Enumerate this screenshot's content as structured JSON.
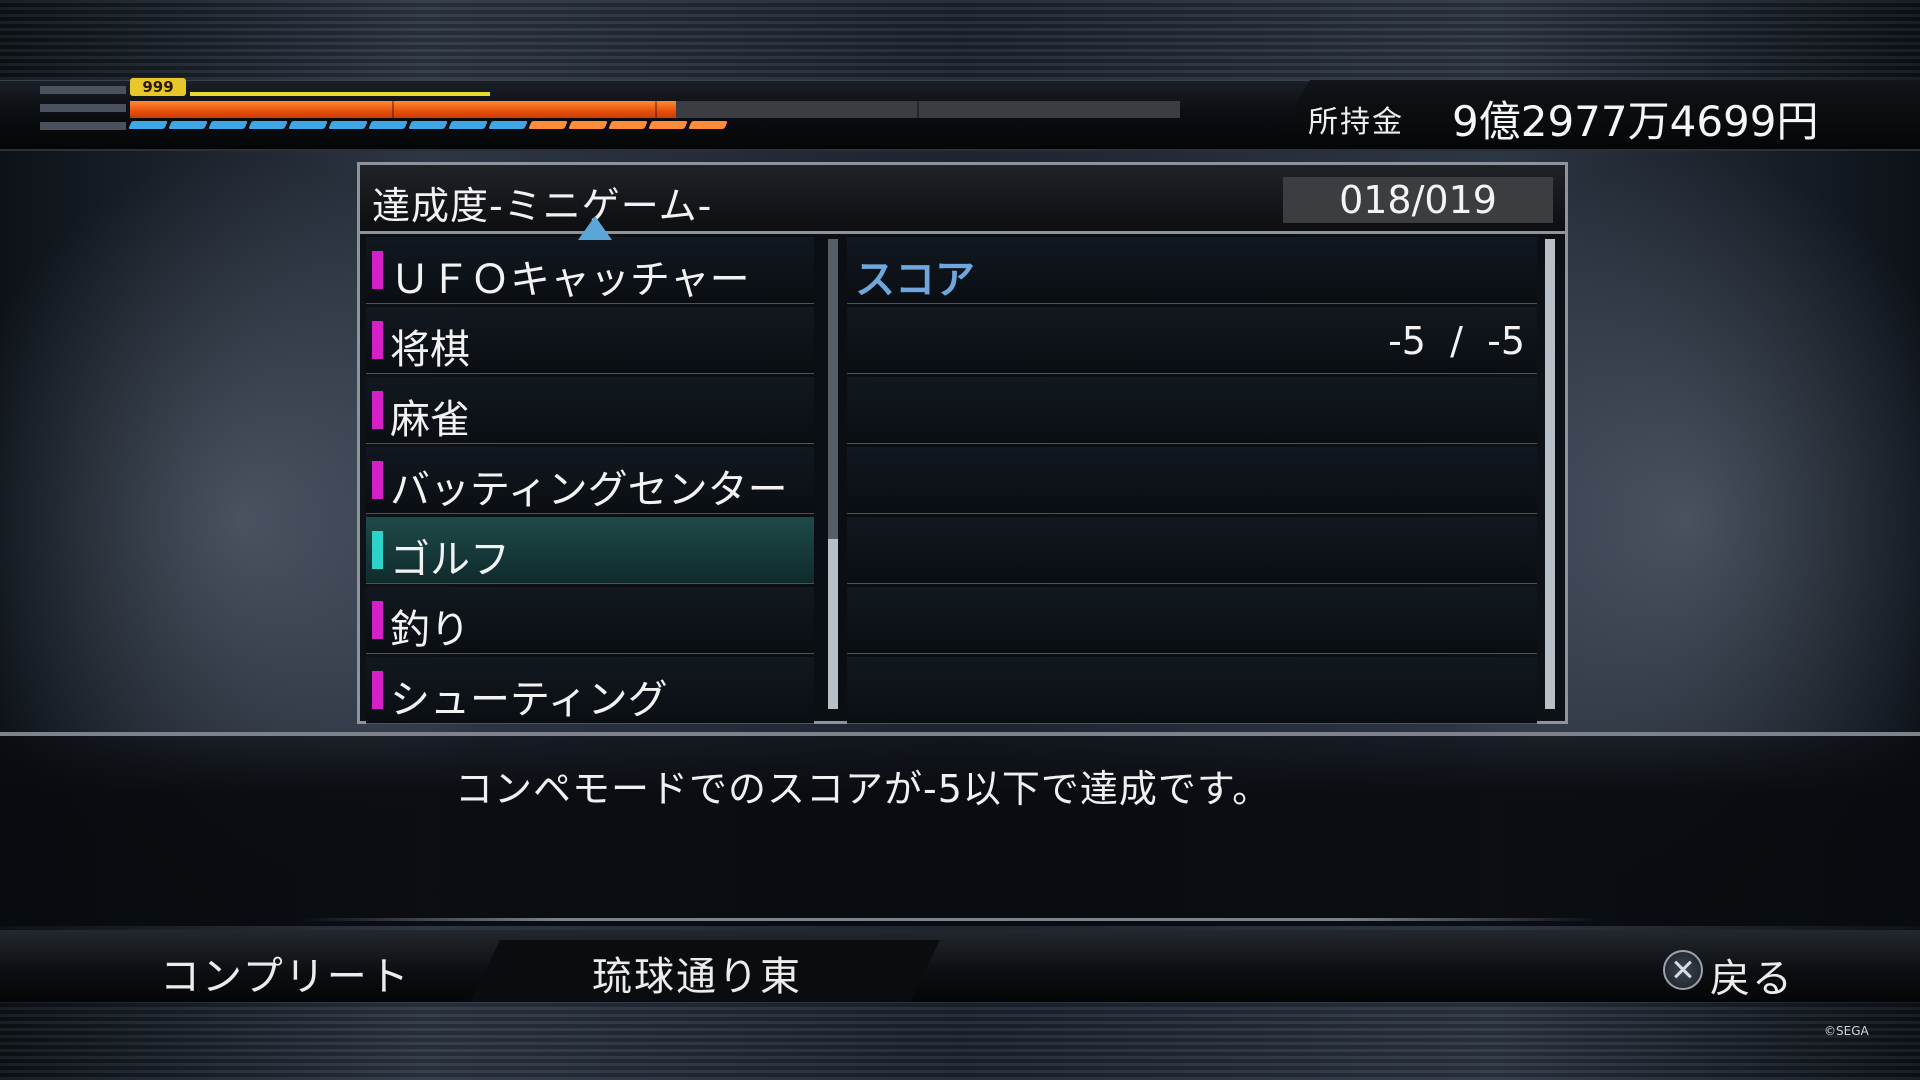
{
  "hud": {
    "level": "999",
    "money_label": "所持金",
    "money_value": "9億2977万4699円",
    "health_fraction": 0.52,
    "heat_colors": [
      "#3fa7e6",
      "#3fa7e6",
      "#3fa7e6",
      "#3fa7e6",
      "#3fa7e6",
      "#3fa7e6",
      "#3fa7e6",
      "#3fa7e6",
      "#3fa7e6",
      "#3fa7e6",
      "#ff8c3a",
      "#ff8c3a",
      "#ff8c3a",
      "#ff8c3a",
      "#ff8c3a"
    ]
  },
  "panel": {
    "title": "達成度-ミニゲーム-",
    "count": "018/019",
    "categories": [
      {
        "label": "ＵＦＯキャッチャー",
        "selected": false
      },
      {
        "label": "将棋",
        "selected": false
      },
      {
        "label": "麻雀",
        "selected": false
      },
      {
        "label": "バッティングセンター",
        "selected": false
      },
      {
        "label": "ゴルフ",
        "selected": true
      },
      {
        "label": "釣り",
        "selected": false
      },
      {
        "label": "シューティング",
        "selected": false
      }
    ],
    "detail_header": "スコア",
    "detail_score": "-5  /  -5",
    "detail_empty_rows": 5
  },
  "description": "コンペモードでのスコアが-5以下で達成です。",
  "bottom": {
    "left_label": "コンプリート",
    "location": "琉球通り東",
    "back_label": "戻る"
  },
  "copyright": "©SEGA",
  "colors": {
    "accent_magenta": "#d51fc9",
    "accent_teal": "#2bd3c9",
    "header_blue": "#6ea7dd"
  }
}
